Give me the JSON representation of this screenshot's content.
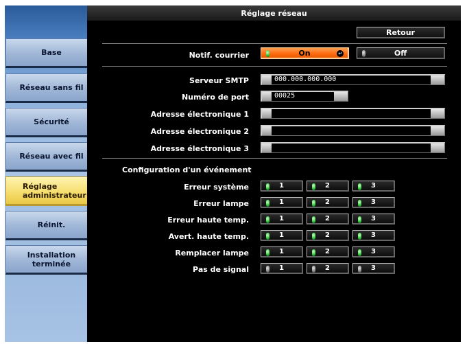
{
  "window": {
    "title": "Réglage réseau"
  },
  "sidebar": {
    "items": [
      {
        "label": "Base",
        "active": false
      },
      {
        "label": "Réseau sans fil",
        "active": false
      },
      {
        "label": "Sécurité",
        "active": false
      },
      {
        "label": "Réseau avec fil",
        "active": false
      },
      {
        "label": "Réglage\nadministrateur",
        "active": true
      },
      {
        "label": "Réinit.",
        "active": false
      },
      {
        "label": "Installation\nterminée",
        "active": false
      }
    ]
  },
  "toolbar": {
    "back_label": "Retour"
  },
  "notif": {
    "label": "Notif. courrier",
    "on_label": "On",
    "off_label": "Off",
    "selected": "On"
  },
  "smtp": {
    "label": "Serveur SMTP",
    "value": "000.000.000.000"
  },
  "port": {
    "label": "Numéro de port",
    "value": "00025"
  },
  "emails": [
    {
      "label": "Adresse électronique 1",
      "value": ""
    },
    {
      "label": "Adresse électronique 2",
      "value": ""
    },
    {
      "label": "Adresse électronique 3",
      "value": ""
    }
  ],
  "events": {
    "section_title": "Configuration d'un événement",
    "columns": [
      "1",
      "2",
      "3"
    ],
    "rows": [
      {
        "label": "Erreur système",
        "checked": [
          true,
          true,
          true
        ]
      },
      {
        "label": "Erreur lampe",
        "checked": [
          true,
          true,
          true
        ]
      },
      {
        "label": "Erreur haute temp.",
        "checked": [
          true,
          true,
          true
        ]
      },
      {
        "label": "Avert. haute temp.",
        "checked": [
          true,
          true,
          true
        ]
      },
      {
        "label": "Remplacer lampe",
        "checked": [
          true,
          true,
          true
        ]
      },
      {
        "label": "Pas de signal",
        "checked": [
          false,
          false,
          false
        ]
      }
    ]
  },
  "colors": {
    "accent_on": "#ff6a10",
    "led_on": "#2ec63a",
    "led_off": "#8a8a8a",
    "selected_menu": "#f5dc6a"
  }
}
